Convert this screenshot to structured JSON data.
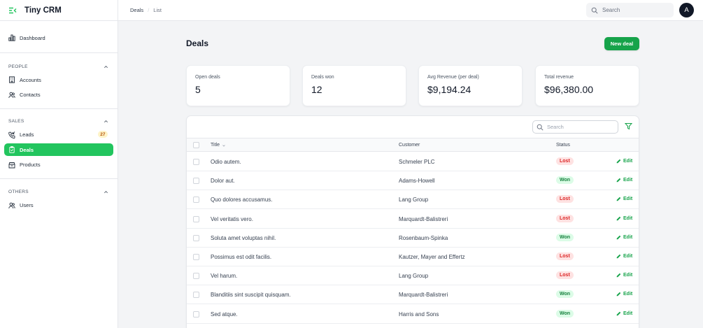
{
  "app": {
    "name": "Tiny CRM"
  },
  "sidebar": {
    "dashboard": "Dashboard",
    "groups": [
      {
        "label": "PEOPLE",
        "items": [
          "Accounts",
          "Contacts"
        ]
      },
      {
        "label": "SALES",
        "items": [
          "Leads",
          "Deals",
          "Products"
        ],
        "leads_badge": "27"
      },
      {
        "label": "OTHERS",
        "items": [
          "Users"
        ]
      }
    ]
  },
  "topbar": {
    "breadcrumb": [
      "Deals",
      "List"
    ],
    "search_placeholder": "Search",
    "avatar_initial": "A"
  },
  "page": {
    "title": "Deals",
    "new_button": "New deal"
  },
  "stats": [
    {
      "label": "Open deals",
      "value": "5"
    },
    {
      "label": "Deals won",
      "value": "12"
    },
    {
      "label": "Avg Revenue (per deal)",
      "value": "$9,194.24"
    },
    {
      "label": "Total revenue",
      "value": "$96,380.00"
    }
  ],
  "table": {
    "search_placeholder": "Search",
    "columns": [
      "Title",
      "Customer",
      "Status"
    ],
    "edit_label": "Edit",
    "rows": [
      {
        "title": "Odio autem.",
        "customer": "Schmeler PLC",
        "status": "Lost"
      },
      {
        "title": "Dolor aut.",
        "customer": "Adams-Howell",
        "status": "Won"
      },
      {
        "title": "Quo dolores accusamus.",
        "customer": "Lang Group",
        "status": "Lost"
      },
      {
        "title": "Vel veritatis vero.",
        "customer": "Marquardt-Balistreri",
        "status": "Lost"
      },
      {
        "title": "Soluta amet voluptas nihil.",
        "customer": "Rosenbaum-Spinka",
        "status": "Won"
      },
      {
        "title": "Possimus est odit facilis.",
        "customer": "Kautzer, Mayer and Effertz",
        "status": "Lost"
      },
      {
        "title": "Vel harum.",
        "customer": "Lang Group",
        "status": "Lost"
      },
      {
        "title": "Blanditiis sint suscipit quisquam.",
        "customer": "Marquardt-Balistreri",
        "status": "Won"
      },
      {
        "title": "Sed atque.",
        "customer": "Harris and Sons",
        "status": "Won"
      }
    ]
  },
  "colors": {
    "accent": "#22c55e",
    "primary_button": "#16a34a",
    "lost": "#dc2626",
    "won": "#15803d"
  }
}
